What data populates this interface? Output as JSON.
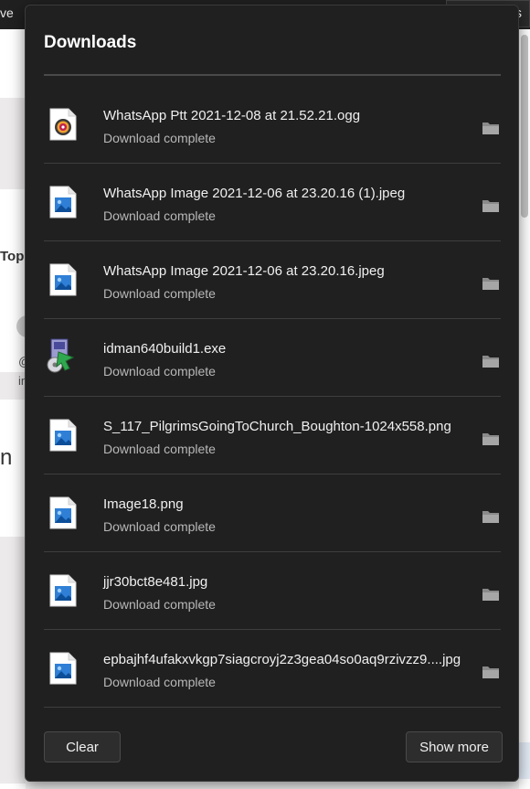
{
  "background": {
    "top_fragment": "ve",
    "tooltip": "Downloads",
    "left_fragments": [
      "Topi",
      "@",
      "in",
      "n"
    ]
  },
  "panel": {
    "title": "Downloads",
    "items": [
      {
        "name": "WhatsApp Ptt 2021-12-08 at 21.52.21.ogg",
        "status": "Download complete",
        "icon": "audio-file-icon"
      },
      {
        "name": "WhatsApp Image 2021-12-06 at 23.20.16 (1).jpeg",
        "status": "Download complete",
        "icon": "image-file-icon"
      },
      {
        "name": "WhatsApp Image 2021-12-06 at 23.20.16.jpeg",
        "status": "Download complete",
        "icon": "image-file-icon"
      },
      {
        "name": "idman640build1.exe",
        "status": "Download complete",
        "icon": "installer-file-icon"
      },
      {
        "name": "S_117_PilgrimsGoingToChurch_Boughton-1024x558.png",
        "status": "Download complete",
        "icon": "image-file-icon"
      },
      {
        "name": "Image18.png",
        "status": "Download complete",
        "icon": "image-file-icon"
      },
      {
        "name": "jjr30bct8e481.jpg",
        "status": "Download complete",
        "icon": "image-file-icon"
      },
      {
        "name": "epbajhf4ufakxvkgp7siagcroyj2z3gea04so0aq9rzivzz9....jpg",
        "status": "Download complete",
        "icon": "image-file-icon"
      }
    ],
    "clear_label": "Clear",
    "show_more_label": "Show more"
  }
}
